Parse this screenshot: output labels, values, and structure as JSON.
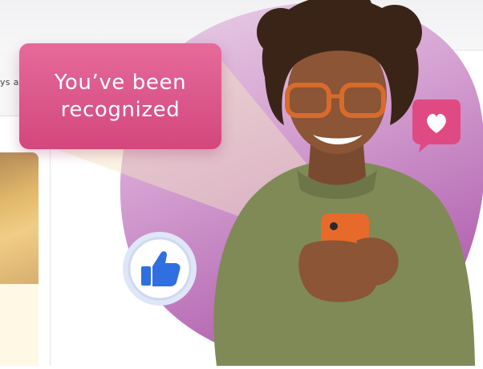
{
  "background_app": {
    "truncated_text": "ys a"
  },
  "notification": {
    "message": "You’ve been\nrecognized"
  },
  "badges": {
    "heart": "heart-icon",
    "like": "thumbs-up-icon"
  },
  "colors": {
    "bubble": "#d94d82",
    "blob": "#c98ac7",
    "like_blue": "#2f6fe0",
    "heart_pink": "#e04a83"
  }
}
